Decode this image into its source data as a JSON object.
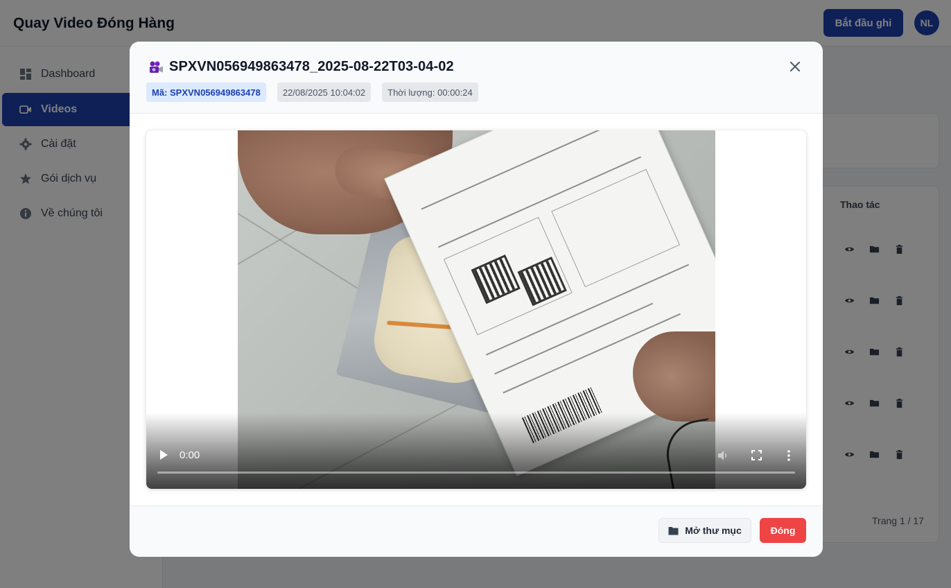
{
  "app": {
    "title": "Quay Video Đóng Hàng",
    "record_label": "Bắt đầu ghi",
    "avatar_initials": "NL"
  },
  "sidebar": {
    "items": [
      {
        "label": "Dashboard",
        "icon": "dashboard-icon",
        "active": false
      },
      {
        "label": "Videos",
        "icon": "video-camera-icon",
        "active": true
      },
      {
        "label": "Cài đặt",
        "icon": "gear-icon",
        "active": false
      },
      {
        "label": "Gói dịch vụ",
        "icon": "star-icon",
        "active": false
      },
      {
        "label": "Về chúng tôi",
        "icon": "info-icon",
        "active": false
      }
    ]
  },
  "table": {
    "actions_header": "Thao tác",
    "row_actions": [
      "eye-icon",
      "folder-icon",
      "trash-icon"
    ],
    "row_count": 5,
    "pagination": "Trang 1 / 17"
  },
  "modal": {
    "title": "SPXVN056949863478_2025-08-22T03-04-02",
    "title_icon": "movie-camera-icon",
    "code_badge": "Mã: SPXVN056949863478",
    "date_badge": "22/08/2025 10:04:02",
    "duration_badge": "Thời lượng: 00:00:24",
    "player": {
      "current_time": "0:00",
      "progress": 0,
      "muted": true
    },
    "open_folder_label": "Mở thư mục",
    "close_label": "Đóng"
  },
  "colors": {
    "primary": "#1e40af",
    "danger": "#ef4444",
    "badge_code_bg": "#dbeafe",
    "badge_bg": "#e5e7eb"
  }
}
